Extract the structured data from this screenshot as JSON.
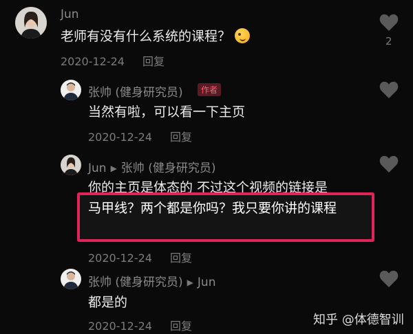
{
  "comments": [
    {
      "username": "Jun",
      "text": "老师有没有什么系统的课程？",
      "emoji": "wink-tongue-emoji",
      "date": "2020-12-24",
      "reply_label": "回复",
      "like_count": "2"
    },
    {
      "username": "张帅 (健身研究员)",
      "badge": "作者",
      "text": "当然有啦，可以看一下主页",
      "date": "2020-12-24",
      "reply_label": "回复"
    },
    {
      "username": "Jun",
      "reply_to": "张帅 (健身研究员)",
      "text_line1": "你的主页是体态的 不过这个视频的链接是",
      "highlight_text": "马甲线？两个都是你吗？我只要你讲的课程",
      "date": "2020-12-24",
      "reply_label": "回复"
    },
    {
      "username": "张帅 (健身研究员)",
      "reply_to": "Jun",
      "text": "都是的",
      "date": "2020-12-24",
      "reply_label": "回复"
    }
  ],
  "watermark": "知乎 @体德智训",
  "colors": {
    "background": "#0a0a0a",
    "highlight_border": "#e0245a",
    "author_badge": "#ff5c6e"
  }
}
